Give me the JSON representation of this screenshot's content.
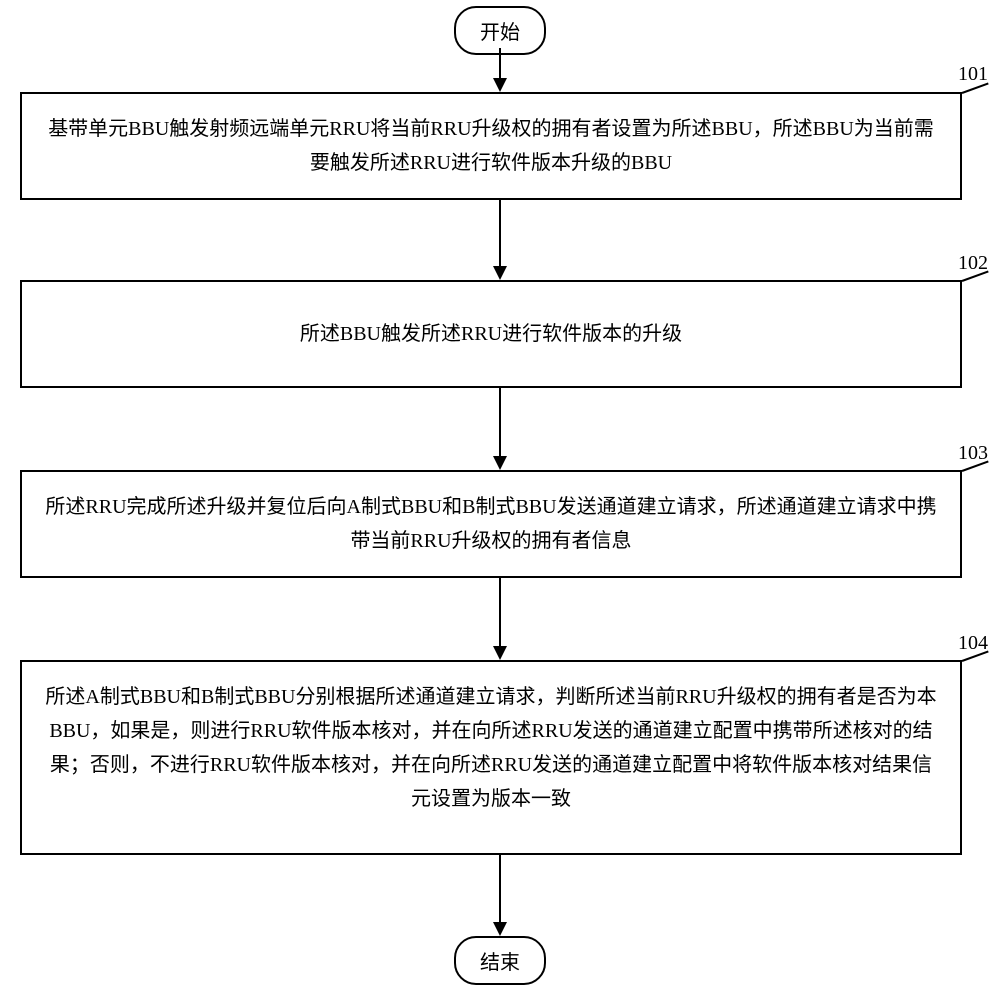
{
  "start_label": "开始",
  "end_label": "结束",
  "refs": {
    "r101": "101",
    "r102": "102",
    "r103": "103",
    "r104": "104"
  },
  "steps": {
    "s101": "基带单元BBU触发射频远端单元RRU将当前RRU升级权的拥有者设置为所述BBU，所述BBU为当前需要触发所述RRU进行软件版本升级的BBU",
    "s102": "所述BBU触发所述RRU进行软件版本的升级",
    "s103": "所述RRU完成所述升级并复位后向A制式BBU和B制式BBU发送通道建立请求，所述通道建立请求中携带当前RRU升级权的拥有者信息",
    "s104": "所述A制式BBU和B制式BBU分别根据所述通道建立请求，判断所述当前RRU升级权的拥有者是否为本BBU，如果是，则进行RRU软件版本核对，并在向所述RRU发送的通道建立配置中携带所述核对的结果；否则，不进行RRU软件版本核对，并在向所述RRU发送的通道建立配置中将软件版本核对结果信元设置为版本一致"
  },
  "chart_data": {
    "type": "flowchart",
    "nodes": [
      {
        "id": "start",
        "type": "terminal",
        "label": "开始"
      },
      {
        "id": "101",
        "type": "process",
        "ref": "101",
        "text": "基带单元BBU触发射频远端单元RRU将当前RRU升级权的拥有者设置为所述BBU，所述BBU为当前需要触发所述RRU进行软件版本升级的BBU"
      },
      {
        "id": "102",
        "type": "process",
        "ref": "102",
        "text": "所述BBU触发所述RRU进行软件版本的升级"
      },
      {
        "id": "103",
        "type": "process",
        "ref": "103",
        "text": "所述RRU完成所述升级并复位后向A制式BBU和B制式BBU发送通道建立请求，所述通道建立请求中携带当前RRU升级权的拥有者信息"
      },
      {
        "id": "104",
        "type": "process",
        "ref": "104",
        "text": "所述A制式BBU和B制式BBU分别根据所述通道建立请求，判断所述当前RRU升级权的拥有者是否为本BBU，如果是，则进行RRU软件版本核对，并在向所述RRU发送的通道建立配置中携带所述核对的结果；否则，不进行RRU软件版本核对，并在向所述RRU发送的通道建立配置中将软件版本核对结果信元设置为版本一致"
      },
      {
        "id": "end",
        "type": "terminal",
        "label": "结束"
      }
    ],
    "edges": [
      {
        "from": "start",
        "to": "101"
      },
      {
        "from": "101",
        "to": "102"
      },
      {
        "from": "102",
        "to": "103"
      },
      {
        "from": "103",
        "to": "104"
      },
      {
        "from": "104",
        "to": "end"
      }
    ]
  }
}
